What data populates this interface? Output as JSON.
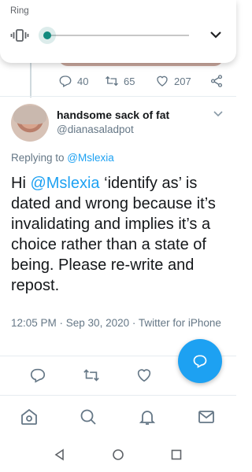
{
  "ring_panel": {
    "label": "Ring",
    "icons": {
      "vibrate": "vibrate-icon",
      "expand": "chevron-down-icon"
    },
    "accent_color": "#128a7e"
  },
  "previous_tweet_actions": {
    "replies": "40",
    "retweets": "65",
    "likes": "207",
    "icons": [
      "reply-icon",
      "retweet-icon",
      "like-icon",
      "share-icon"
    ]
  },
  "tweet": {
    "display_name": "handsome sack of fat",
    "handle": "@dianasaladpot",
    "replying_prefix": "Replying to ",
    "replying_to": "@Mslexia",
    "text_prefix": "Hi ",
    "text_mention": "@Mslexia",
    "text_body": " ‘identify as’ is dated and wrong because it’s invalidating and implies it’s a choice rather than a state of being. Please re-write and repost.",
    "timestamp": "12:05 PM · Sep 30, 2020 · Twitter for iPhone",
    "icons": [
      "reply-icon",
      "retweet-icon",
      "like-icon",
      "more-caret-icon"
    ]
  },
  "fab": {
    "icon": "compose-reply-icon",
    "color": "#1da1f2"
  },
  "bottom_nav": {
    "items": [
      "home-icon",
      "search-icon",
      "notifications-icon",
      "messages-icon"
    ]
  },
  "system_nav": {
    "items": [
      "back-icon",
      "home-circle-icon",
      "recents-icon"
    ]
  }
}
